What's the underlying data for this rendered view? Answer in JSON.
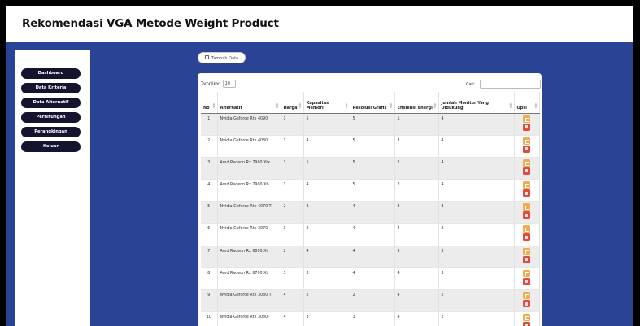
{
  "app": {
    "title": "Rekomendasi VGA Metode Weight Product"
  },
  "colors": {
    "background": "#2a4394",
    "nav_button": "#14142e",
    "edit_button": "#f0ad4e",
    "delete_button": "#e5483f"
  },
  "sidebar": {
    "items": [
      {
        "label": "Dashboard"
      },
      {
        "label": "Data Kriteria"
      },
      {
        "label": "Data Alternatif"
      },
      {
        "label": "Perhitungan"
      },
      {
        "label": "Perangkingan"
      },
      {
        "label": "Keluar"
      }
    ]
  },
  "toolbar": {
    "add_label": "Tambah Data",
    "add_icon": "plus-square-icon"
  },
  "table_controls": {
    "length_label": "Tampilkan",
    "length_value": "10",
    "search_label": "Cari:",
    "search_placeholder": ""
  },
  "table": {
    "columns": [
      "No",
      "Alternatif",
      "Harga",
      "Kapasitas Memori",
      "Resolusi Grafis",
      "Efisiensi Energi",
      "Jumlah Monitor Yang Didukung",
      "Opsi"
    ],
    "rows": [
      [
        "1",
        "Nvidia Geforce Rtx 4090",
        "1",
        "5",
        "5",
        "1",
        "4"
      ],
      [
        "2",
        "Nvidia Geforce Rtx 4080",
        "1",
        "4",
        "5",
        "3",
        "4"
      ],
      [
        "3",
        "Amd Radeon Rx 7900 Xtx",
        "1",
        "5",
        "5",
        "2",
        "4"
      ],
      [
        "4",
        "Amd Radeon Rx 7900 Xt-",
        "1",
        "4",
        "5",
        "2",
        "4"
      ],
      [
        "5",
        "Nvidia Geforce Rtx 4070 Ti",
        "2",
        "3",
        "4",
        "3",
        "3"
      ],
      [
        "6",
        "Nvidia Geforce Rtx 3070",
        "3",
        "2",
        "4",
        "4",
        "3"
      ],
      [
        "7",
        "Amd Radeon Rx 6800 Xt",
        "2",
        "4",
        "4",
        "3",
        "3"
      ],
      [
        "8",
        "Amd Radeon Rx 6700 Xt",
        "3",
        "3",
        "4",
        "4",
        "3"
      ],
      [
        "9",
        "Nvidia Geforce Rtx 3080 Ti",
        "4",
        "2",
        "2",
        "4",
        "2"
      ],
      [
        "10",
        "Nvidia Geforce Rtx 3080-",
        "4",
        "3",
        "3",
        "4",
        "2"
      ]
    ],
    "edit_icon": "edit-icon",
    "delete_icon": "trash-icon"
  }
}
